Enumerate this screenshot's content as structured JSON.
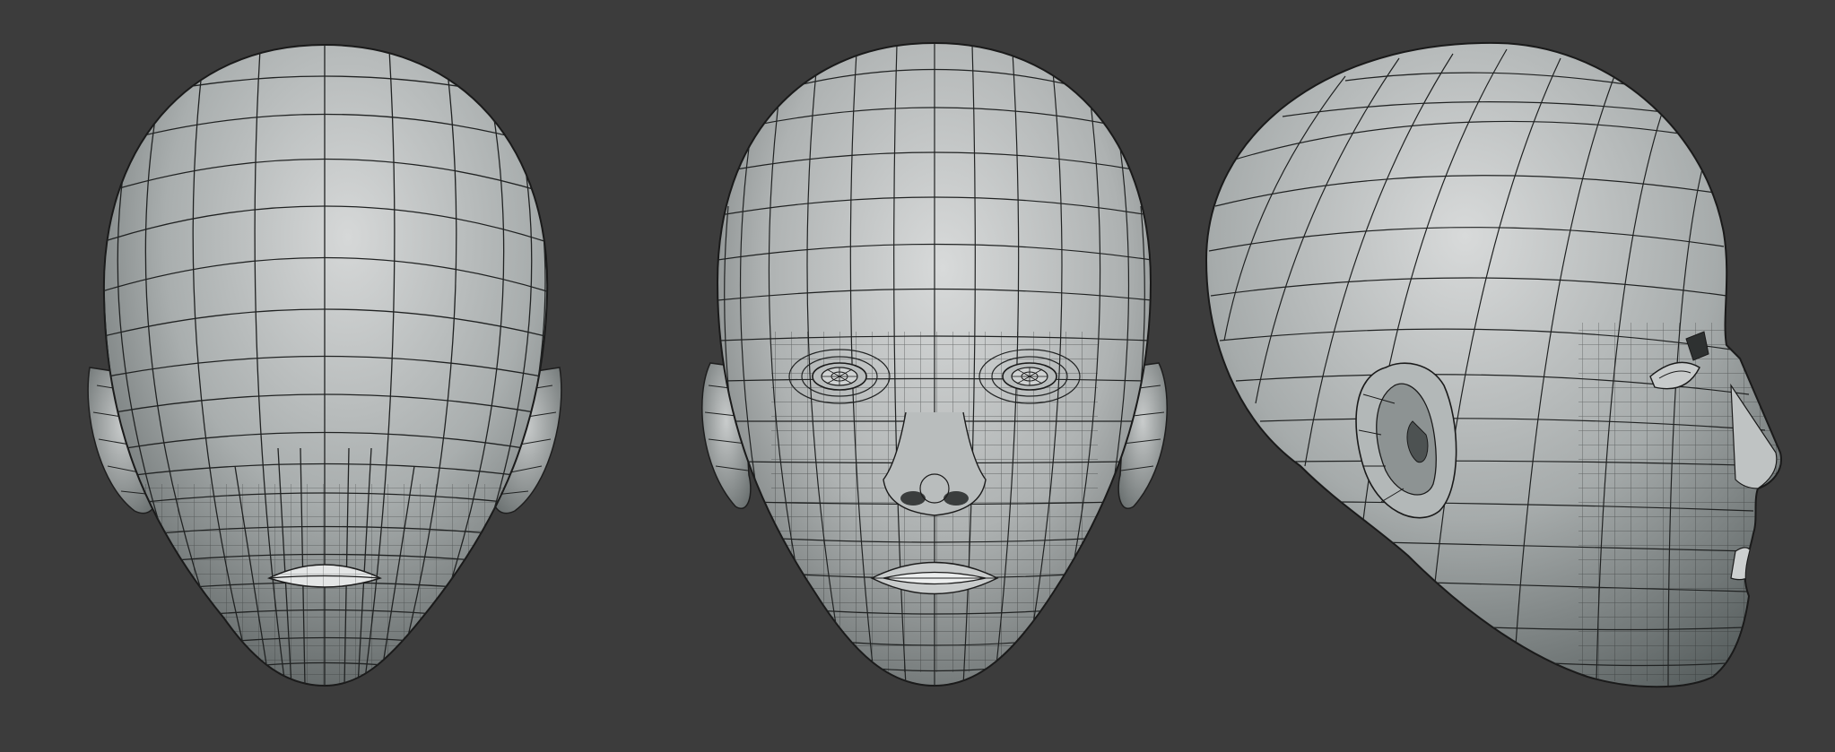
{
  "scene": {
    "background_color": "#3c3c3c",
    "mesh_fill_light": "#d4d6d6",
    "mesh_fill_mid": "#9ea3a3",
    "mesh_fill_dark": "#5c6262",
    "wire_color": "#1c1c1c"
  },
  "views": [
    {
      "id": "top-view",
      "description_icon": "head-topology-top-view"
    },
    {
      "id": "front-view",
      "description_icon": "head-topology-front-view"
    },
    {
      "id": "side-view",
      "description_icon": "head-topology-side-view"
    }
  ]
}
